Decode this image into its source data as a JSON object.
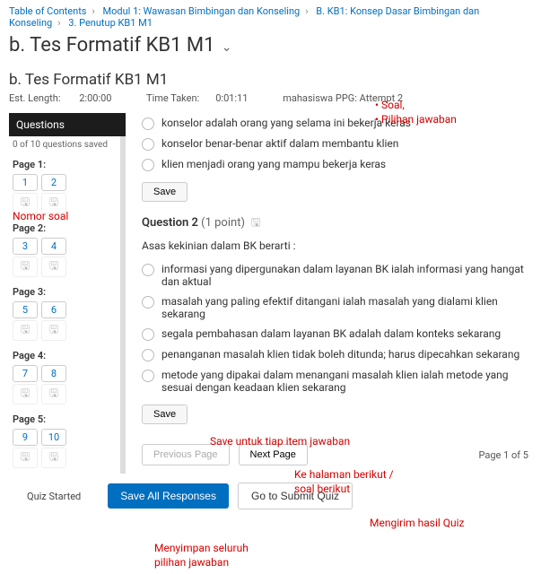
{
  "breadcrumb": {
    "items": [
      "Table of Contents",
      "Modul 1: Wawasan Bimbingan dan Konseling",
      "B. KB1: Konsep Dasar Bimbingan dan Konseling",
      "3. Penutup KB1 M1"
    ]
  },
  "page_title": "b. Tes Formatif KB1 M1",
  "sub_title": "b. Tes Formatif KB1 M1",
  "meta": {
    "est_label": "Est. Length:",
    "est_value": "2:00:00",
    "time_label": "Time Taken:",
    "time_value": "0:01:11",
    "attempt": "mahasiswa PPG: Attempt 2"
  },
  "sidebar": {
    "header": "Questions",
    "saved": "0 of 10 questions saved",
    "pages": [
      {
        "label": "Page 1:",
        "nums": [
          "1",
          "2"
        ]
      },
      {
        "label": "Page 2:",
        "nums": [
          "3",
          "4"
        ]
      },
      {
        "label": "Page 3:",
        "nums": [
          "5",
          "6"
        ]
      },
      {
        "label": "Page 4:",
        "nums": [
          "7",
          "8"
        ]
      },
      {
        "label": "Page 5:",
        "nums": [
          "9",
          "10"
        ]
      }
    ]
  },
  "q1": {
    "opts": [
      "konselor adalah orang yang selama ini bekerja keras",
      "konselor benar-benar aktif dalam membantu klien",
      "klien menjadi orang yang mampu bekerja keras"
    ],
    "save": "Save"
  },
  "q2": {
    "title": "Question 2",
    "points": "(1 point)",
    "stem": "Asas kekinian dalam BK berarti :",
    "opts": [
      "informasi yang dipergunakan dalam layanan BK ialah informasi yang hangat dan aktual",
      "masalah yang paling efektif ditangani ialah masalah yang dialami klien sekarang",
      "segala pembahasan dalam layanan BK adalah dalam konteks sekarang",
      "penanganan masalah klien tidak boleh ditunda; harus dipecahkan sekarang",
      "metode yang dipakai dalam menangani masalah klien ialah metode yang sesuai dengan keadaan klien sekarang"
    ],
    "save": "Save"
  },
  "pager": {
    "prev": "Previous Page",
    "next": "Next Page",
    "count": "Page 1 of 5"
  },
  "footer": {
    "status": "Quiz Started",
    "save_all": "Save All Responses",
    "submit": "Go to Submit Quiz"
  },
  "ann": {
    "soal": "Soal,",
    "pilihan": "Pilihan jawaban",
    "nomor": "Nomor soal",
    "save_item": "Save untuk tiap item jawaban",
    "next_l1": "Ke halaman berikut /",
    "next_l2": "soal berikut",
    "submit": "Mengirim hasil Quiz",
    "saveall_l1": "Menyimpan seluruh",
    "saveall_l2": "pilihan jawaban"
  }
}
